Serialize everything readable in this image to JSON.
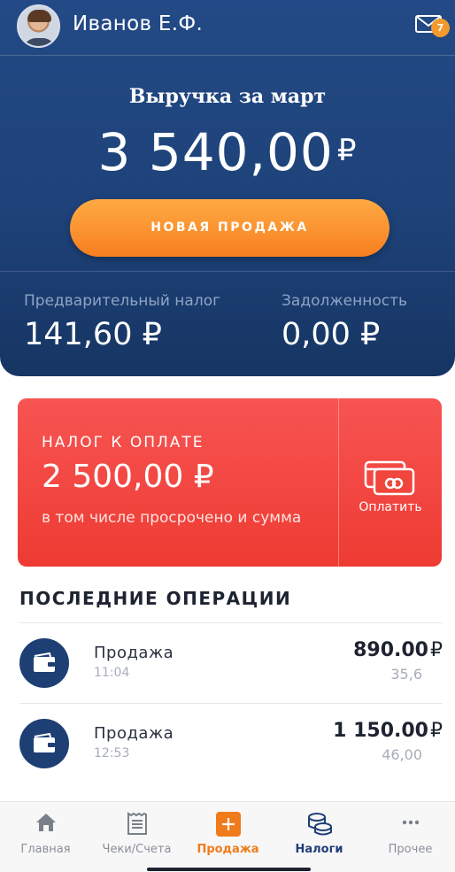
{
  "header": {
    "user_name": "Иванов Е.Ф.",
    "notifications_count": "7",
    "avatar_icon": "user-avatar",
    "mail_icon": "envelope-icon"
  },
  "summary": {
    "revenue_title": "Выручка за март",
    "revenue_amount": "3 540,00",
    "currency": "₽",
    "new_sale_label": "НОВАЯ ПРОДАЖА",
    "prepaid_tax_label": "Предварительный налог",
    "prepaid_tax_value": "141,60 ₽",
    "debt_label": "Задолженность",
    "debt_value": "0,00 ₽"
  },
  "tax_due": {
    "label": "НАЛОГ К ОПЛАТЕ",
    "amount": "2 500,00 ₽",
    "note": "в том числе просрочено и сумма",
    "pay_label": "Оплатить",
    "pay_icon": "credit-cards-icon"
  },
  "operations": {
    "title": "ПОСЛЕДНИЕ ОПЕРАЦИИ",
    "items": [
      {
        "name": "Продажа",
        "time": "11:04",
        "amount": "890.00",
        "currency": "₽",
        "tax": "35,6",
        "icon": "wallet-icon"
      },
      {
        "name": "Продажа",
        "time": "12:53",
        "amount": "1 150.00",
        "currency": "₽",
        "tax": "46,00",
        "icon": "wallet-icon"
      }
    ]
  },
  "tabbar": {
    "items": [
      {
        "label": "Главная",
        "icon": "home-icon"
      },
      {
        "label": "Чеки/Счета",
        "icon": "receipt-icon"
      },
      {
        "label": "Продажа",
        "icon": "plus-icon"
      },
      {
        "label": "Налоги",
        "icon": "coins-icon"
      },
      {
        "label": "Прочее",
        "icon": "more-icon"
      }
    ]
  },
  "colors": {
    "primary_blue": "#1e4279",
    "accent_orange": "#f77f20",
    "alert_red": "#ee3b32",
    "active_tab_orange": "#f07b1a",
    "active_tab_blue": "#1e3f73"
  }
}
